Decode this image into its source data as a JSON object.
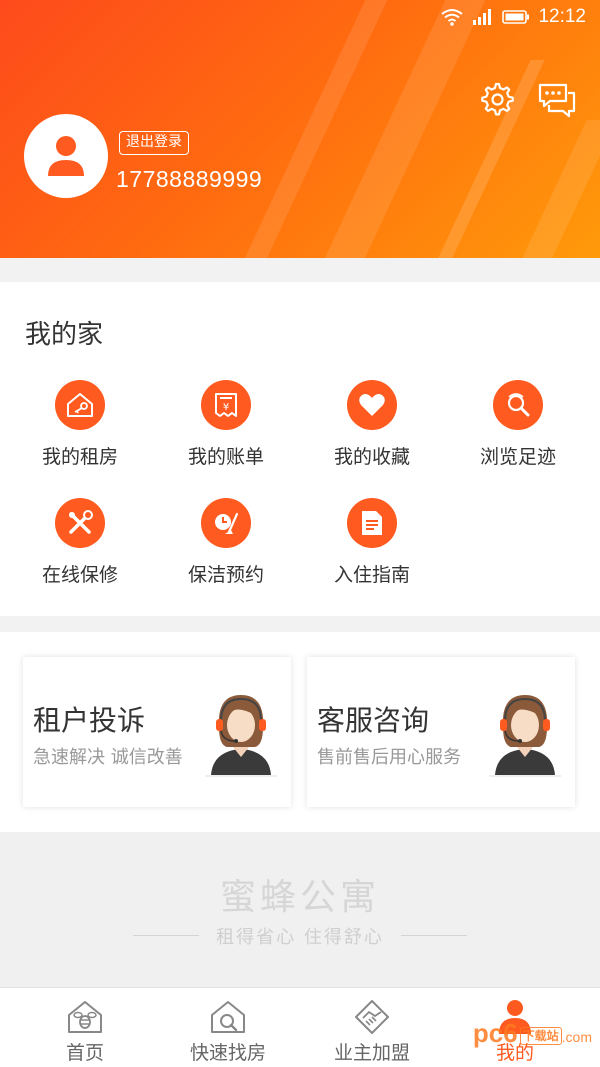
{
  "status_bar": {
    "time": "12:12"
  },
  "header": {
    "logout_label": "退出登录",
    "phone": "17788889999",
    "settings_icon": "gear-icon",
    "messages_icon": "chat-icon"
  },
  "my_home": {
    "title": "我的家",
    "items": [
      {
        "label": "我的租房",
        "icon": "house-key-icon"
      },
      {
        "label": "我的账单",
        "icon": "bill-icon"
      },
      {
        "label": "我的收藏",
        "icon": "heart-icon"
      },
      {
        "label": "浏览足迹",
        "icon": "footprint-search-icon"
      },
      {
        "label": "在线保修",
        "icon": "tools-icon"
      },
      {
        "label": "保洁预约",
        "icon": "broom-clock-icon"
      },
      {
        "label": "入住指南",
        "icon": "document-icon"
      }
    ]
  },
  "cards": [
    {
      "title": "租户投诉",
      "subtitle": "急速解决  诚信改善"
    },
    {
      "title": "客服咨询",
      "subtitle": "售前售后用心服务"
    }
  ],
  "brand": {
    "name": "蜜蜂公寓",
    "slogan": "租得省心 住得舒心"
  },
  "tabs": [
    {
      "label": "首页",
      "icon": "bee-house-icon"
    },
    {
      "label": "快速找房",
      "icon": "house-search-icon"
    },
    {
      "label": "业主加盟",
      "icon": "handshake-icon"
    },
    {
      "label": "我的",
      "icon": "person-icon",
      "active": true
    }
  ],
  "watermark": {
    "text": "pc6",
    "suffix": "下载站",
    "domain": ".com"
  },
  "colors": {
    "accent": "#ff5a1f",
    "header_start": "#fe4a1c",
    "header_end": "#ff9a0a"
  }
}
